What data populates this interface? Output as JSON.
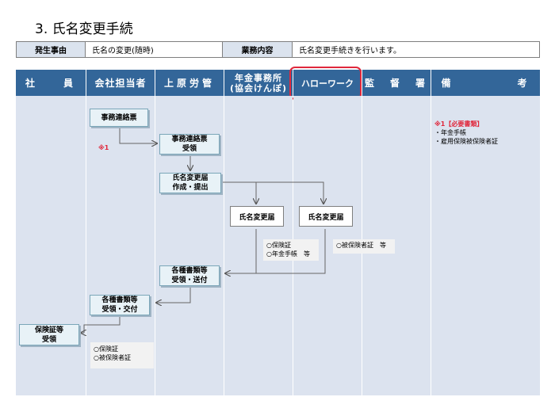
{
  "title": "3. 氏名変更手続",
  "info": {
    "label1": "発生事由",
    "value1": "氏名の変更(随時)",
    "label2": "業務内容",
    "value2": "氏名変更手続きを行います。"
  },
  "columns": {
    "employee": "社　　員",
    "company": "会社担当者",
    "hr": "上原労管",
    "pension_line1": "年金事務所",
    "pension_line2": "(協会けんぽ)",
    "hellowork": "ハローワーク",
    "labor": "監　督　署",
    "remarks": "備　　　　　考"
  },
  "flow": {
    "contact_note": "事務連絡票",
    "marker": "※1",
    "contact_receive_1": "事務連絡票",
    "contact_receive_2": "受領",
    "create_1": "氏名変更届",
    "create_2": "作成・提出",
    "doc_pension": "氏名変更届",
    "doc_hellowork": "氏名変更届",
    "pension_note_1": "○保険証",
    "pension_note_2": "○年金手帳　等",
    "hellowork_note": "○被保険者証　等",
    "docs_send_1": "各種書類等",
    "docs_send_2": "受領・送付",
    "docs_deliver_1": "各種書類等",
    "docs_deliver_2": "受領・交付",
    "employee_receive_1": "保険証等",
    "employee_receive_2": "受領",
    "employee_note_1": "○保険証",
    "employee_note_2": "○被保険者証"
  },
  "remarks": {
    "heading": "※1【必要書類】",
    "item1": "・年金手帳",
    "item2": "・雇用保険被保険者証"
  },
  "colors": {
    "header": "#336699",
    "lane": "#dce3ef",
    "highlight": "#e0283c"
  }
}
